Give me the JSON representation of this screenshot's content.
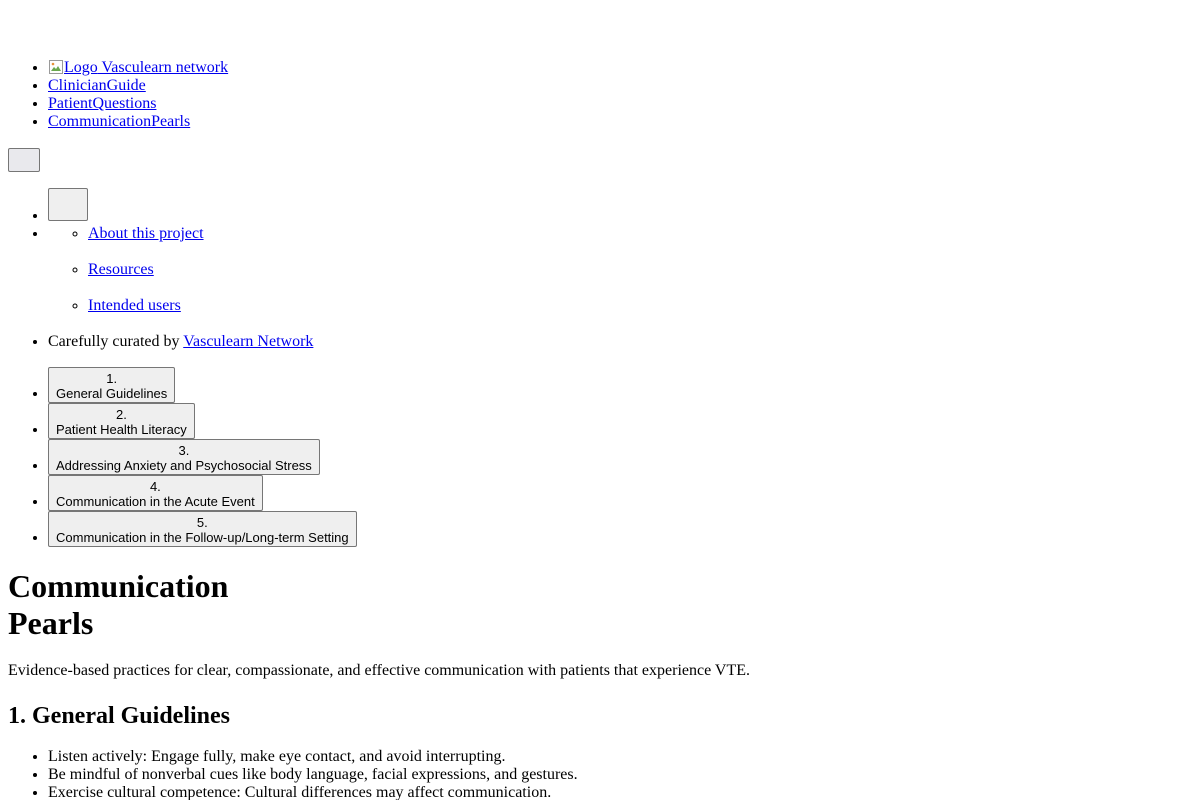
{
  "nav": {
    "logo_alt": "Logo",
    "logo_text": "Vasculearn network",
    "items": [
      {
        "label": "ClinicianGuide"
      },
      {
        "label": "PatientQuestions"
      },
      {
        "label": "CommunicationPearls"
      }
    ]
  },
  "submenu": {
    "links": [
      {
        "label": "About this project"
      },
      {
        "label": "Resources"
      },
      {
        "label": "Intended users"
      }
    ],
    "curated_prefix": "Carefully curated by",
    "curated_link": "Vasculearn Network"
  },
  "sections": [
    {
      "number": "1.",
      "label": "General Guidelines"
    },
    {
      "number": "2.",
      "label": "Patient Health Literacy"
    },
    {
      "number": "3.",
      "label": "Addressing Anxiety and Psychosocial Stress"
    },
    {
      "number": "4.",
      "label": "Communication in the Acute Event"
    },
    {
      "number": "5.",
      "label": "Communication in the Follow-up/Long-term Setting"
    }
  ],
  "main": {
    "title_line1": "Communication",
    "title_line2": "Pearls",
    "subtitle": "Evidence-based practices for clear, compassionate, and effective communication with patients that experience VTE.",
    "section_heading": "1. General Guidelines",
    "guidelines": [
      "Listen actively: Engage fully, make eye contact, and avoid interrupting.",
      "Be mindful of nonverbal cues like body language, facial expressions, and gestures.",
      "Exercise cultural competence: Cultural differences may affect communication."
    ]
  }
}
